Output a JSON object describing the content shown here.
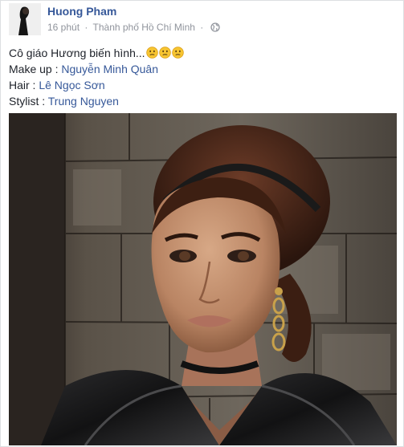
{
  "post": {
    "author": "Huong Pham",
    "time": "16 phút",
    "separator": "·",
    "location": "Thành phố Hồ Chí Minh",
    "audience_icon": "globe-icon",
    "caption_text": "Cô giáo Hương biến hình...",
    "caption_emoticons": [
      "confused-emoticon",
      "confused-emoticon",
      "confused-emoticon"
    ],
    "credits": [
      {
        "label": "Make up : ",
        "name": "Nguyễn Minh Quân"
      },
      {
        "label": "Hair : ",
        "name": "Lê Ngọc Sơn"
      },
      {
        "label": "Stylist : ",
        "name": "Trung Nguyen"
      }
    ]
  },
  "colors": {
    "link": "#365899",
    "text": "#1d2129",
    "meta": "#90949c",
    "emoticon": "#f7c531"
  }
}
